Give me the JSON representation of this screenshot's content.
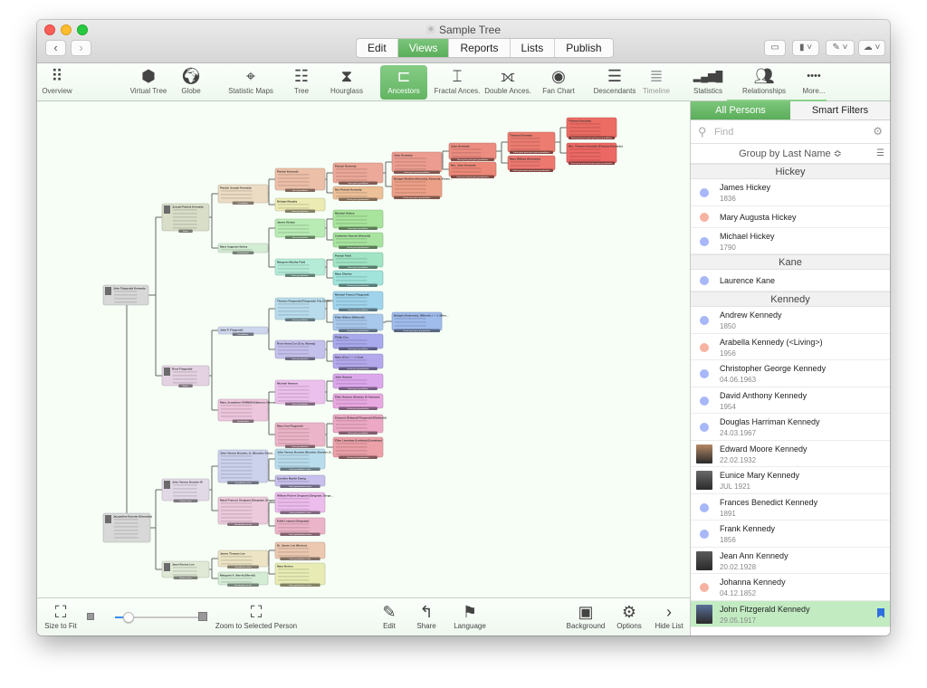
{
  "window": {
    "title": "Sample Tree",
    "nav": {
      "back": "‹",
      "forward": "›"
    },
    "modes": [
      {
        "label": "Edit",
        "active": false
      },
      {
        "label": "Views",
        "active": true
      },
      {
        "label": "Reports",
        "active": false
      },
      {
        "label": "Lists",
        "active": false
      },
      {
        "label": "Publish",
        "active": false
      }
    ],
    "right_buttons": [
      {
        "icon": "window-icon",
        "glyph": "▭"
      },
      {
        "icon": "bookmark-menu-icon",
        "glyph": "▮ ˅"
      },
      {
        "icon": "tag-menu-icon",
        "glyph": "✎ ˅"
      },
      {
        "icon": "cloud-menu-icon",
        "glyph": "☁ ˅"
      }
    ]
  },
  "views": [
    {
      "label": "Overview",
      "icon": "grid-icon",
      "glyph": "⠿",
      "active": false
    },
    {
      "label": "Virtual Tree",
      "icon": "cube-icon",
      "glyph": "⬢",
      "active": false
    },
    {
      "label": "Globe",
      "icon": "globe-icon",
      "glyph": "🌍︎",
      "active": false
    },
    {
      "label": "Statistic Maps",
      "icon": "map-pin-icon",
      "glyph": "⌖",
      "active": false
    },
    {
      "label": "Tree",
      "icon": "tree-chart-icon",
      "glyph": "☷",
      "active": false
    },
    {
      "label": "Hourglass",
      "icon": "hourglass-chart-icon",
      "glyph": "⧗",
      "active": false
    },
    {
      "label": "Ancestors",
      "icon": "ancestors-chart-icon",
      "glyph": "⊏",
      "active": true
    },
    {
      "label": "Fractal Ances.",
      "icon": "fractal-chart-icon",
      "glyph": "⌶",
      "active": false
    },
    {
      "label": "Double Ances.",
      "icon": "double-ancestors-icon",
      "glyph": "⟗",
      "active": false
    },
    {
      "label": "Fan Chart",
      "icon": "fan-chart-icon",
      "glyph": "◉",
      "active": false
    },
    {
      "label": "Descendants",
      "icon": "descendants-chart-icon",
      "glyph": "☰",
      "active": false
    },
    {
      "label": "Timeline",
      "icon": "timeline-icon",
      "glyph": "≣",
      "active": false,
      "dim": true
    },
    {
      "label": "Statistics",
      "icon": "bar-chart-icon",
      "glyph": "▂▄▆█",
      "active": false
    },
    {
      "label": "Relationships",
      "icon": "relationships-icon",
      "glyph": "👥︎",
      "active": false
    },
    {
      "label": "More...",
      "icon": "more-icon",
      "glyph": "••••",
      "active": false
    }
  ],
  "bottom": {
    "size_to_fit": "Size to Fit",
    "zoom_selected": "Zoom to Selected Person",
    "zoom_level": 0.15,
    "edit": "Edit",
    "share": "Share",
    "language": "Language",
    "background": "Background",
    "options": "Options",
    "hide_list": "Hide List"
  },
  "sidebar": {
    "tabs": [
      {
        "label": "All Persons",
        "active": true
      },
      {
        "label": "Smart Filters",
        "active": false
      }
    ],
    "find_placeholder": "Find",
    "group_by": "Group by Last Name ≎",
    "groups": [
      {
        "name": "Hickey",
        "persons": [
          {
            "name": "James Hickey",
            "date": "1836",
            "sex": "male"
          },
          {
            "name": "Mary Augusta Hickey",
            "date": "",
            "sex": "female"
          },
          {
            "name": "Michael Hickey",
            "date": "1790",
            "sex": "male"
          }
        ]
      },
      {
        "name": "Kane",
        "persons": [
          {
            "name": "Laurence Kane",
            "date": "",
            "sex": "male"
          }
        ]
      },
      {
        "name": "Kennedy",
        "persons": [
          {
            "name": "Andrew Kennedy",
            "date": "1850",
            "sex": "male"
          },
          {
            "name": "Arabella Kennedy (<Living>)",
            "date": "1956",
            "sex": "female"
          },
          {
            "name": "Christopher George Kennedy",
            "date": "04.06.1963",
            "sex": "male"
          },
          {
            "name": "David Anthony Kennedy",
            "date": "1954",
            "sex": "male"
          },
          {
            "name": "Douglas Harriman Kennedy",
            "date": "24.03.1967",
            "sex": "male"
          },
          {
            "name": "Edward Moore Kennedy",
            "date": "22.02.1932",
            "sex": "photo",
            "photo": "#b58a66"
          },
          {
            "name": "Eunice Mary Kennedy",
            "date": "JUL 1921",
            "sex": "photo",
            "photo": "#6a6a6a"
          },
          {
            "name": "Frances Benedict Kennedy",
            "date": "1891",
            "sex": "male"
          },
          {
            "name": "Frank Kennedy",
            "date": "1856",
            "sex": "male"
          },
          {
            "name": "Jean Ann Kennedy",
            "date": "20.02.1928",
            "sex": "photo",
            "photo": "#5a5a5a"
          },
          {
            "name": "Johanna Kennedy",
            "date": "04.12.1852",
            "sex": "female"
          },
          {
            "name": "John Fitzgerald Kennedy",
            "date": "29.05.1917",
            "sex": "photo",
            "photo": "#5a6f9a",
            "selected": true,
            "bookmarked": true
          }
        ]
      }
    ]
  },
  "tree": {
    "nodes": [
      {
        "id": "jfk",
        "name": "John Fitzgerald Kennedy",
        "color": "#d8d8d8",
        "badge": "",
        "gen": 0
      },
      {
        "id": "jbk",
        "name": "Jacqueline Bouvier (Kennedy)",
        "color": "#d8d8d8",
        "badge": "",
        "gen": 0
      },
      {
        "id": "jpk",
        "name": "Joseph Patrick Kennedy",
        "color": "#d9dec9",
        "badge": "Father",
        "gen": 1
      },
      {
        "id": "rfk",
        "name": "Rose Fitzgerald",
        "color": "#e4d2e2",
        "badge": "Mother",
        "gen": 1
      },
      {
        "id": "jvb",
        "name": "John Vernou Bouvier III",
        "color": "#e2d9e6",
        "badge": "Father-in-law",
        "gen": 1
      },
      {
        "id": "jnl",
        "name": "Janet Norton Lee",
        "color": "#dfe9d6",
        "badge": "Mother-in-law",
        "gen": 1
      },
      {
        "id": "pjk",
        "name": "Patrick Joseph Kennedy",
        "color": "#ecdcc4",
        "badge": "Grandfather",
        "gen": 2
      },
      {
        "id": "mah",
        "name": "Mary Augusta Hickey",
        "color": "#d4ecd4",
        "badge": "Grandmother",
        "gen": 2
      },
      {
        "id": "jff",
        "name": "John F. Fitzgerald",
        "color": "#cdd6ec",
        "badge": "Grandfather",
        "gen": 2
      },
      {
        "id": "mjh",
        "name": "Mary Josephine HANNON (Hannon, Hannan, Hannon, Hannon)",
        "color": "#ecc6dc",
        "badge": "Grandmother",
        "gen": 2
      },
      {
        "id": "jvb2",
        "name": "John Vernou Bouvier, Jr. (Bouvier, Bouvier, Bouvier, Bouvier, Bouvier, Bouvier, Jr., Bouvier)",
        "color": "#ccd2ec",
        "badge": "Grandfather-in-law",
        "gen": 2
      },
      {
        "id": "mfs",
        "name": "Maud Frances Sergeant (Sergeant, Sergeant, Sergeant, Sergeant, Sergeant)",
        "color": "#eccadc",
        "badge": "Grandmother-in-law",
        "gen": 2
      },
      {
        "id": "jtl",
        "name": "James Thomas Lee",
        "color": "#ece4c4",
        "badge": "Grandfather-in-law",
        "gen": 2
      },
      {
        "id": "mam",
        "name": "Margaret A. Merritt (Merritt)",
        "color": "#d4ecd4",
        "badge": "Grandmother-in-law",
        "gen": 2
      },
      {
        "id": "pk",
        "name": "Patrick Kennedy",
        "color": "#ecbfa8",
        "badge": "Great grandfather",
        "gen": 3
      },
      {
        "id": "bm",
        "name": "Bridget Murphy",
        "color": "#ecebb4",
        "badge": "Great grandmother",
        "gen": 3
      },
      {
        "id": "jh",
        "name": "James Hickey",
        "color": "#b8ecb4",
        "badge": "Great grandfather",
        "gen": 3
      },
      {
        "id": "mmf",
        "name": "Margaret Martha Field",
        "color": "#b4ecd8",
        "badge": "Great grandmother",
        "gen": 3
      },
      {
        "id": "tf",
        "name": "Thomas Fitzgerald (Fitzgerald, Fitz GERALD, GERALD)",
        "color": "#b8dcec",
        "badge": "Great grandfather",
        "gen": 3
      },
      {
        "id": "rac",
        "name": "Rose Anna Cox (Cox, Murray)",
        "color": "#c4c0ec",
        "badge": "Great grandmother",
        "gen": 3
      },
      {
        "id": "mh",
        "name": "Michael Hannon",
        "color": "#ecc0ec",
        "badge": "Great grandfather",
        "gen": 3
      },
      {
        "id": "maf",
        "name": "Mary Ann Fitzgerald",
        "color": "#ecb4c8",
        "badge": "Great grandmother",
        "gen": 3
      },
      {
        "id": "jvbb",
        "name": "John Vernou Bouvier (Bouvier, Bouvier, Bouvier)",
        "color": "#b8dcec",
        "badge": "Great grandfather-in-law",
        "gen": 3
      },
      {
        "id": "cme",
        "name": "Caroline Maslin Ewing",
        "color": "#c8c0ec",
        "badge": "Great grandmother-in-law",
        "gen": 3
      },
      {
        "id": "wrs",
        "name": "William Robert Sergeant (Sergeant, Sergeant)",
        "color": "#ecbcec",
        "badge": "Great grandfather-in-law",
        "gen": 3
      },
      {
        "id": "els",
        "name": "Edith Leaman (Sergeant)",
        "color": "#ecb4c8",
        "badge": "Great grandmother-in-law",
        "gen": 3
      },
      {
        "id": "jl",
        "name": "Dr. James Lee (Norton)",
        "color": "#ecc8b0",
        "badge": "Great grandfather-in-law",
        "gen": 3
      },
      {
        "id": "mn",
        "name": "Mary Norton",
        "color": "#e8ecb4",
        "badge": "Great grandmother-in-law",
        "gen": 3
      },
      {
        "id": "pk2",
        "name": "Patrick Kennedy",
        "color": "#eca898",
        "badge": "Great great grandfather",
        "gen": 4
      },
      {
        "id": "mpk",
        "name": "Mrs Patrick Kennedy",
        "color": "#ecc098",
        "badge": "Great great grandmother",
        "gen": 4
      },
      {
        "id": "mhk",
        "name": "Michael Hickey",
        "color": "#a8e49c",
        "badge": "Great great grandfather",
        "gen": 4
      },
      {
        "id": "chh",
        "name": "Catherine Hassen (Hassett)",
        "color": "#a8e4a0",
        "badge": "Great great grandmother",
        "gen": 4
      },
      {
        "id": "pf",
        "name": "Patrick Field",
        "color": "#a0e4c4",
        "badge": "Great great grandfather",
        "gen": 4
      },
      {
        "id": "ms",
        "name": "Mary Sheehy",
        "color": "#a0e4dc",
        "badge": "Great great grandmother",
        "gen": 4
      },
      {
        "id": "mff",
        "name": "Michael Francis Fitzgerald",
        "color": "#a0d4ec",
        "badge": "Great great grandfather",
        "gen": 4
      },
      {
        "id": "ewf",
        "name": "Ellen Wilmot (Wilmoth)",
        "color": "#a8c8ec",
        "badge": "Great great grandmother",
        "gen": 4
      },
      {
        "id": "pc",
        "name": "Philip Cox",
        "color": "#a8a8ec",
        "badge": "Great great grandfather",
        "gen": 4
      },
      {
        "id": "mc",
        "name": "Mary (Cox, / — ), Cox)",
        "color": "#b4a8ec",
        "badge": "Great great grandmother",
        "gen": 4
      },
      {
        "id": "jhn",
        "name": "John Hannon",
        "color": "#dca8ec",
        "badge": "Great great grandfather",
        "gen": 4
      },
      {
        "id": "ehn",
        "name": "Ellen Hannon (Hannan Or Hannon)",
        "color": "#e8a8e0",
        "badge": "Great great grandmother",
        "gen": 4
      },
      {
        "id": "eef",
        "name": "Edmond (Edward) Fitzgerald (Fitzlerald)",
        "color": "#eca8c4",
        "badge": "Great great grandfather",
        "gen": 4
      },
      {
        "id": "ell",
        "name": "Ellen Linnehan (Lenihan) (Linnehan)",
        "color": "#eca0a8",
        "badge": "Great great grandmother",
        "gen": 4
      },
      {
        "id": "jk",
        "name": "John Kennedy",
        "color": "#ec9c90",
        "badge": "Great great great grandfather",
        "gen": 5
      },
      {
        "id": "bsk",
        "name": "Bridget Shallow (Kennedy, Kennedy, Kennedy)",
        "color": "#eca088",
        "badge": "Great great great grandmother",
        "gen": 5
      },
      {
        "id": "bsw",
        "name": "Bridget (Andersen), Wilmoth, / — ), Wilmoth)",
        "color": "#a0bcec",
        "badge": "Great great great grandmother",
        "gen": 5
      },
      {
        "id": "jk2",
        "name": "John Kennedy",
        "color": "#ec8c80",
        "badge": "Great great great great grandfather",
        "gen": 6
      },
      {
        "id": "mjk",
        "name": "Mrs. John Kennedy",
        "color": "#ec8878",
        "badge": "Great great great great grandmother",
        "gen": 6
      },
      {
        "id": "tk",
        "name": "Thomas Kennedy",
        "color": "#ec7c70",
        "badge": "Great great great great great grandfather",
        "gen": 7
      },
      {
        "id": "mwk",
        "name": "Mary William (Kennedy)",
        "color": "#ec7870",
        "badge": "Great great great great great grandmother",
        "gen": 7
      },
      {
        "id": "tk2",
        "name": "Thomas Kennedy",
        "color": "#ec6c64",
        "badge": "Great great great great great great grandfather",
        "gen": 8
      },
      {
        "id": "mtk",
        "name": "Mrs. Thomas Kennedy (Thomas Kennedy)",
        "color": "#ec6864",
        "badge": "Great great great great great great grandmother",
        "gen": 8
      }
    ]
  }
}
